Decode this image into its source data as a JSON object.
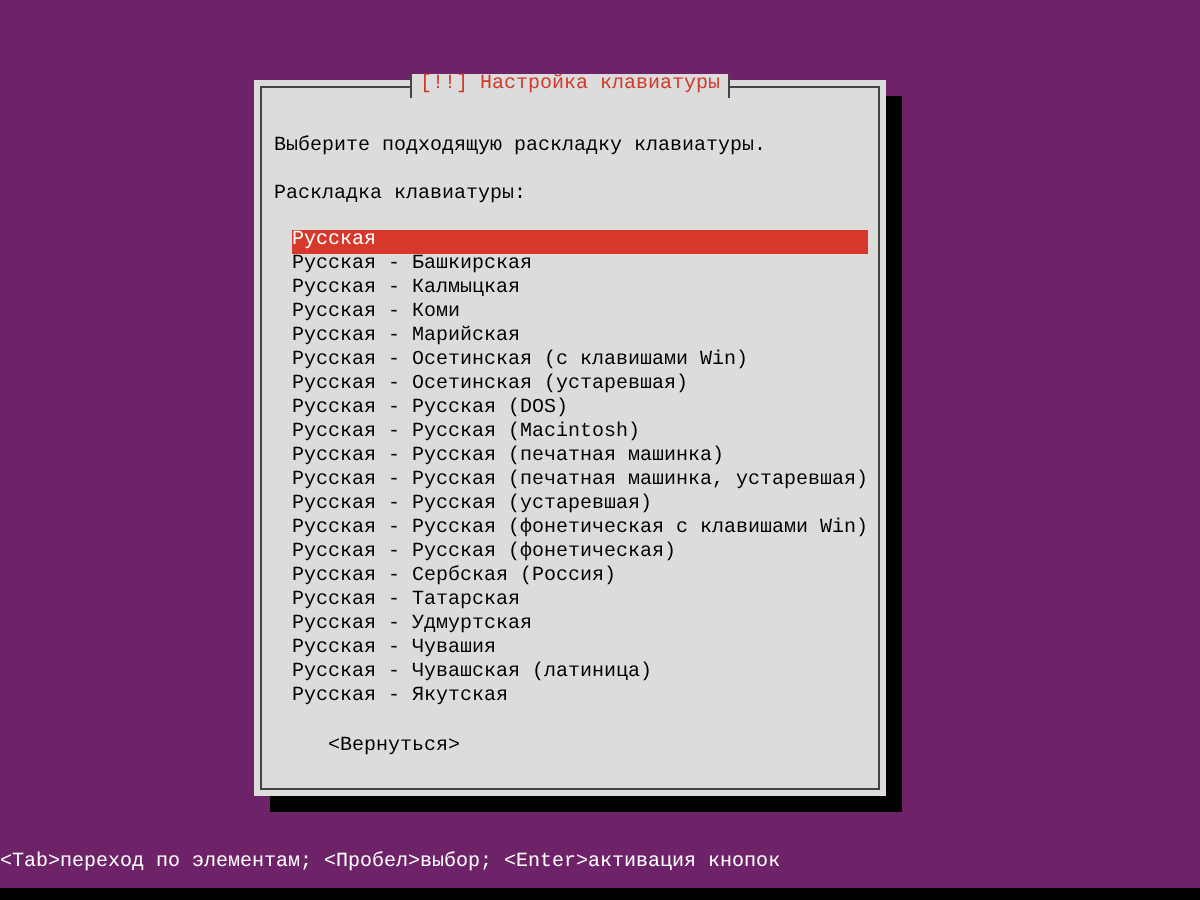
{
  "dialog": {
    "title": "[!!] Настройка клавиатуры",
    "prompt": "Выберите подходящую раскладку клавиатуры.",
    "list_label": "Раскладка клавиатуры:",
    "items": [
      {
        "label": "Русская",
        "selected": true
      },
      {
        "label": "Русская - Башкирская",
        "selected": false
      },
      {
        "label": "Русская - Калмыцкая",
        "selected": false
      },
      {
        "label": "Русская - Коми",
        "selected": false
      },
      {
        "label": "Русская - Марийская",
        "selected": false
      },
      {
        "label": "Русская - Осетинская (с клавишами Win)",
        "selected": false
      },
      {
        "label": "Русская - Осетинская (устаревшая)",
        "selected": false
      },
      {
        "label": "Русская - Русская (DOS)",
        "selected": false
      },
      {
        "label": "Русская - Русская (Macintosh)",
        "selected": false
      },
      {
        "label": "Русская - Русская (печатная машинка)",
        "selected": false
      },
      {
        "label": "Русская - Русская (печатная машинка, устаревшая)",
        "selected": false
      },
      {
        "label": "Русская - Русская (устаревшая)",
        "selected": false
      },
      {
        "label": "Русская - Русская (фонетическая с клавишами Win)",
        "selected": false
      },
      {
        "label": "Русская - Русская (фонетическая)",
        "selected": false
      },
      {
        "label": "Русская - Сербская (Россия)",
        "selected": false
      },
      {
        "label": "Русская - Татарская",
        "selected": false
      },
      {
        "label": "Русская - Удмуртская",
        "selected": false
      },
      {
        "label": "Русская - Чувашия",
        "selected": false
      },
      {
        "label": "Русская - Чувашская (латиница)",
        "selected": false
      },
      {
        "label": "Русская - Якутская",
        "selected": false
      }
    ],
    "button": "<Вернуться>"
  },
  "status_bar": "<Tab>переход по элементам; <Пробел>выбор; <Enter>активация кнопок"
}
